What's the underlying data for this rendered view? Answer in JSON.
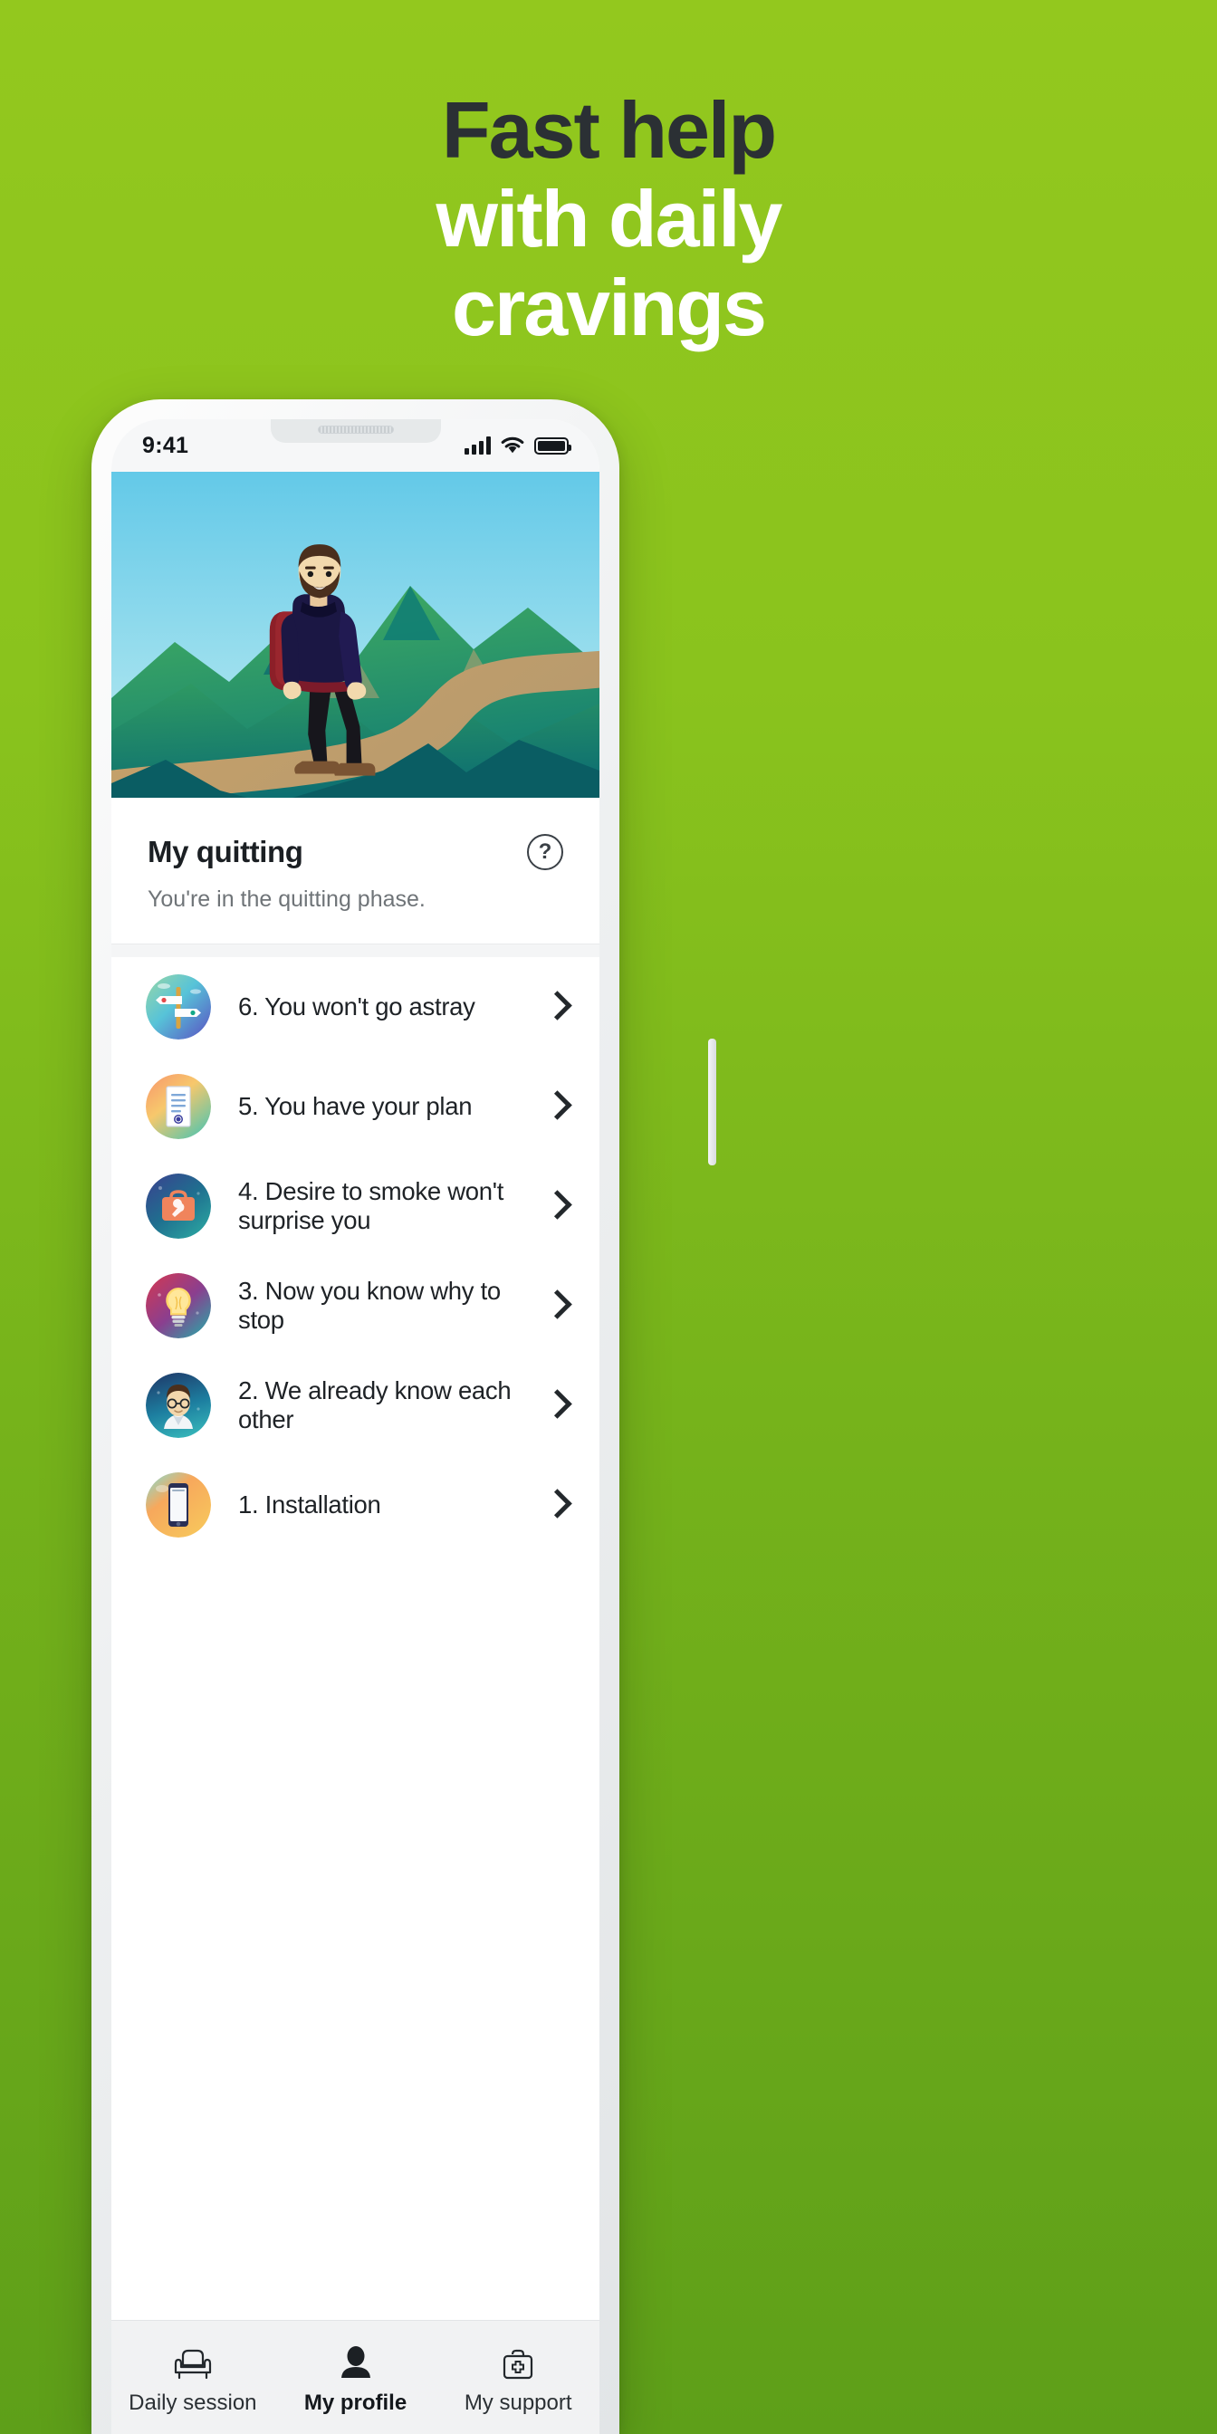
{
  "promo": {
    "headline_line1": "Fast help",
    "headline_line2": "with daily",
    "headline_line3": "cravings",
    "bg_top_color": "#93c81e",
    "bg_bottom_color": "#5e9f19",
    "line1_color": "#2b3034",
    "line2_color": "#ffffff"
  },
  "phone": {
    "statusbar": {
      "time": "9:41",
      "signal_icon": "cellular-signal-icon",
      "wifi_icon": "wifi-icon",
      "battery_icon": "battery-full-icon"
    },
    "hero": {
      "alt": "illustration-hiker-on-mountain-path",
      "sky_color": "#7fd3ea",
      "mountain_color": "#34a05a",
      "shadow_color": "#0d5a63",
      "path_color": "#c8a269"
    },
    "card": {
      "title": "My quitting",
      "subtitle": "You're in the quitting phase.",
      "help_icon": "question-mark-circle-icon",
      "help_glyph": "?"
    },
    "list": [
      {
        "label": "6. You won't go astray",
        "icon": "signpost-icon",
        "chevron": "chevron-right-icon"
      },
      {
        "label": "5. You have your plan",
        "icon": "document-icon",
        "chevron": "chevron-right-icon"
      },
      {
        "label": "4. Desire to smoke won't surprise you",
        "icon": "toolbox-icon",
        "chevron": "chevron-right-icon"
      },
      {
        "label": "3. Now you know why to stop",
        "icon": "lightbulb-icon",
        "chevron": "chevron-right-icon"
      },
      {
        "label": "2. We already know each other",
        "icon": "avatar-icon",
        "chevron": "chevron-right-icon"
      },
      {
        "label": "1. Installation",
        "icon": "smartphone-icon",
        "chevron": "chevron-right-icon"
      }
    ],
    "tabs": [
      {
        "label": "Daily session",
        "icon": "armchair-icon",
        "active": false
      },
      {
        "label": "My profile",
        "icon": "person-icon",
        "active": true
      },
      {
        "label": "My support",
        "icon": "medical-bag-icon",
        "active": false
      }
    ]
  }
}
